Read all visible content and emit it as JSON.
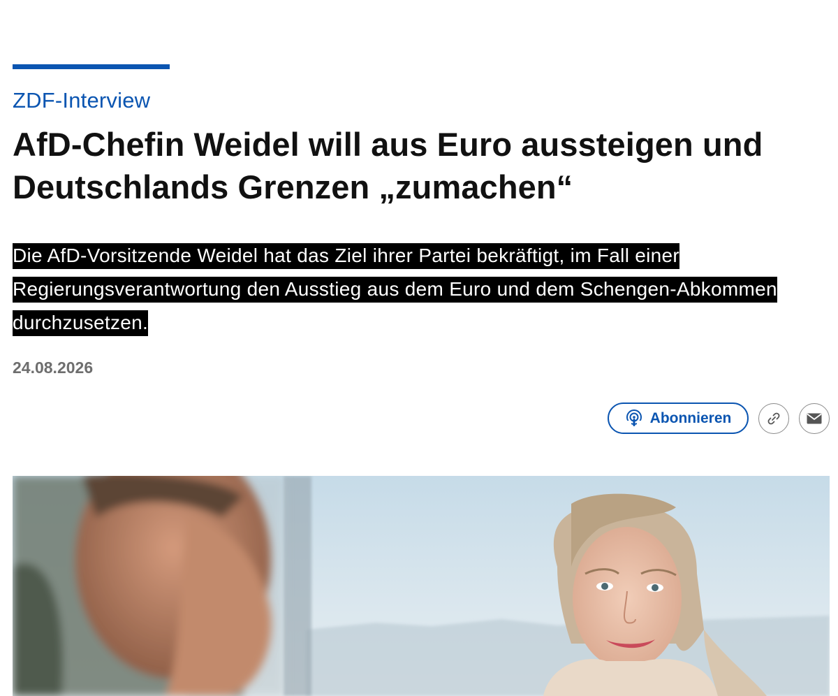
{
  "article": {
    "kicker": "ZDF-Interview",
    "headline": "AfD-Chefin Weidel will aus Euro aussteigen und Deutschlands Grenzen „zumachen“",
    "lead": "Die AfD-Vorsitzende Weidel hat das Ziel ihrer Partei bekräftigt, im Fall einer Regierungsverantwortung den Ausstieg aus dem Euro und dem Schengen-Abkommen durchzusetzen.",
    "date": "24.08.2026"
  },
  "actions": {
    "subscribe_label": "Abonnieren",
    "subscribe_icon": "podcast-icon",
    "link_icon": "link-icon",
    "mail_icon": "mail-icon"
  },
  "colors": {
    "accent": "#0b55b1",
    "text": "#111111",
    "muted": "#6e6e6e",
    "highlight": "#000000"
  }
}
